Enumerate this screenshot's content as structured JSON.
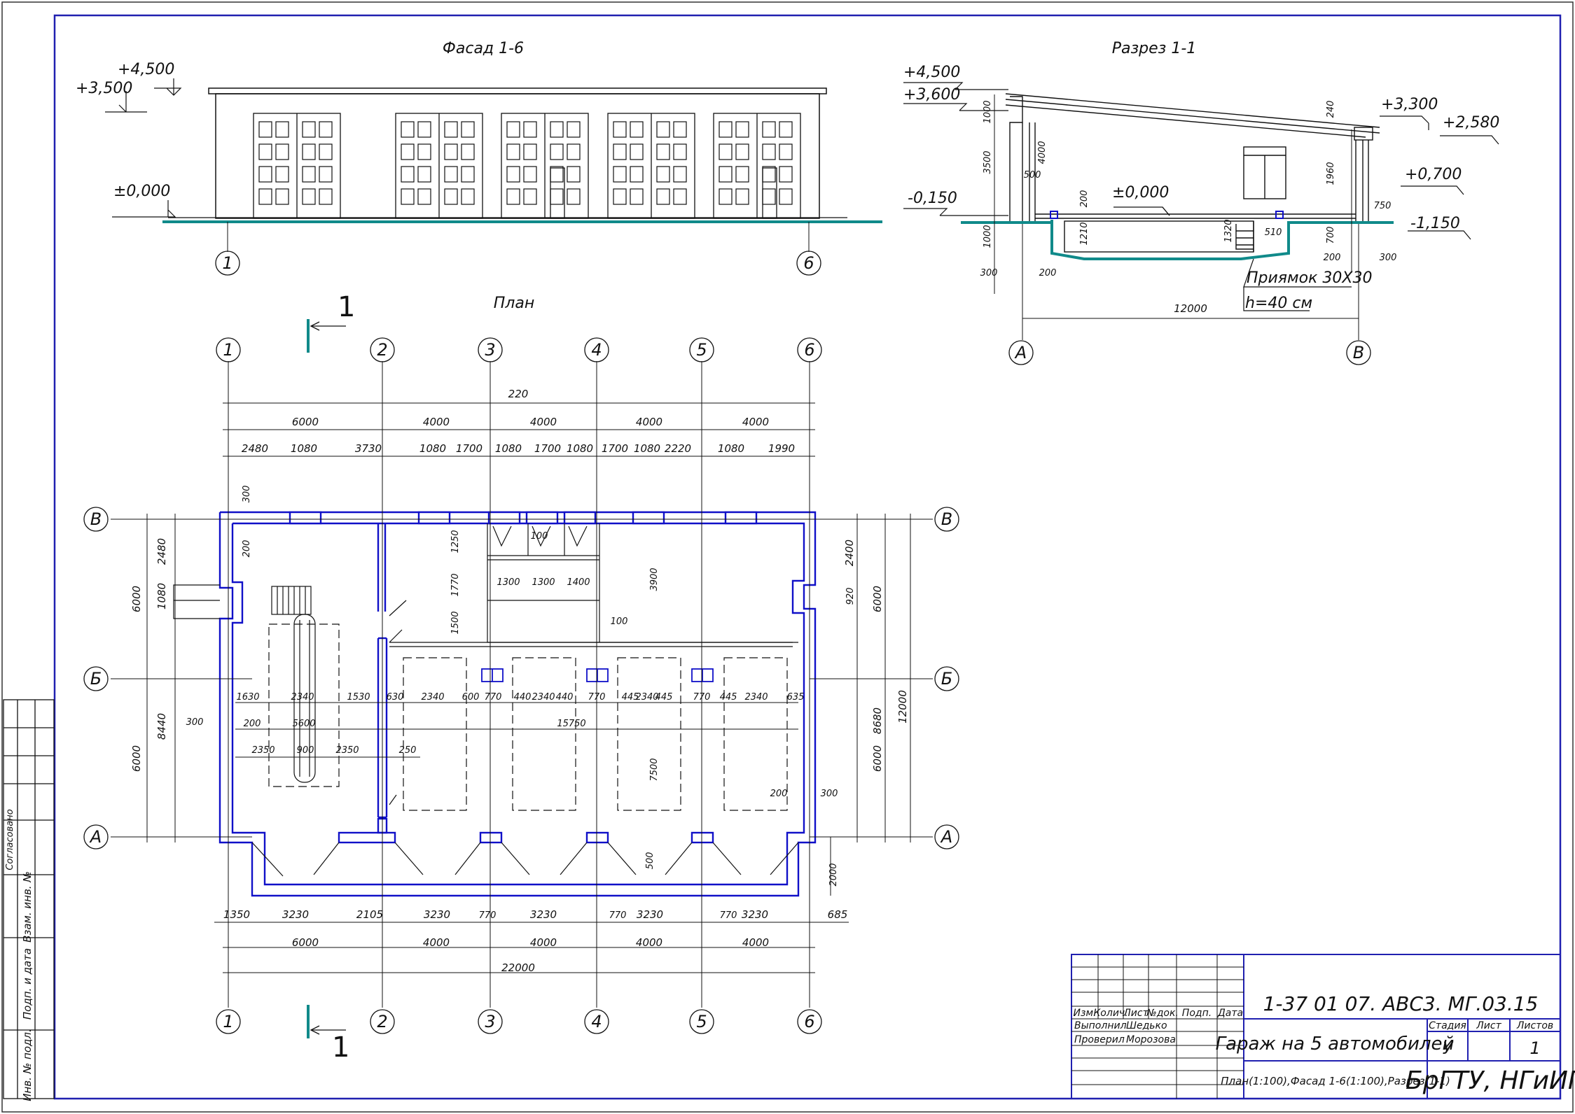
{
  "facade": {
    "title": "Фасад 1-6",
    "levels": [
      "+4,500",
      "+3,500",
      "±0,000"
    ],
    "axes": [
      "1",
      "6"
    ]
  },
  "section": {
    "title": "Разрез 1-1",
    "levels_left": [
      "+4,500",
      "+3,600",
      "-0,150"
    ],
    "levels_right": [
      "+3,300",
      "+2,580",
      "+0,700",
      "-1,150"
    ],
    "floor_level": "±0,000",
    "dims": [
      "1000",
      "3500",
      "1000",
      "300",
      "200",
      "500",
      "4000",
      "200",
      "1210",
      "1320",
      "510",
      "240",
      "1960",
      "700",
      "750",
      "200",
      "300",
      "12000"
    ],
    "pit_note": [
      "Приямок 30Х30",
      "h=40 см"
    ],
    "axes": [
      "А",
      "В"
    ]
  },
  "plan": {
    "title": "План",
    "section_mark": "1",
    "axes_x": [
      "1",
      "2",
      "3",
      "4",
      "5",
      "6"
    ],
    "axes_y": [
      "В",
      "Б",
      "А"
    ],
    "top_total": "220",
    "top_spans": [
      "6000",
      "4000",
      "4000",
      "4000",
      "4000"
    ],
    "top_details": [
      "2480",
      "1080",
      "3730",
      "1080",
      "1700",
      "1080",
      "1700",
      "1080",
      "1700",
      "1080",
      "2220",
      "1080",
      "1990"
    ],
    "bottom_details": [
      "1350",
      "3230",
      "2105",
      "3230",
      "770",
      "3230",
      "770",
      "3230",
      "770",
      "3230",
      "685"
    ],
    "bottom_spans": [
      "6000",
      "4000",
      "4000",
      "4000",
      "4000"
    ],
    "bottom_total": "22000",
    "left_dims": [
      "300",
      "200",
      "2480",
      "1080",
      "6000",
      "8440",
      "300",
      "6000"
    ],
    "right_dims": [
      "2400",
      "920",
      "6000",
      "8680",
      "12000",
      "6000",
      "300",
      "2000"
    ],
    "inner_dims": [
      "1250",
      "100",
      "1770",
      "1300",
      "1300",
      "1400",
      "1500",
      "100",
      "3900",
      "1630",
      "2340",
      "1530",
      "630",
      "2340",
      "600",
      "770",
      "440",
      "2340",
      "440",
      "770",
      "445",
      "2340",
      "445",
      "770",
      "445",
      "2340",
      "635",
      "200",
      "5600",
      "15750",
      "2350",
      "900",
      "2350",
      "250",
      "7500",
      "200",
      "500"
    ]
  },
  "side_stamp": {
    "labels": [
      "Согласовано",
      "Взам. инв. №",
      "Подп. и дата",
      "Инв. № подл."
    ]
  },
  "title_block": {
    "code": "1-37 01 07. АВС3. МГ.03.15",
    "headers": [
      "Изм.",
      "Колич.",
      "Лист",
      "№док.",
      "Подп.",
      "Дата"
    ],
    "roles": [
      "Выполнил",
      "Проверил"
    ],
    "names": [
      "Шедько",
      "Морозова"
    ],
    "object_name": "Гараж на 5 автомобилей",
    "stage_headers": [
      "Стадия",
      "Лист",
      "Листов"
    ],
    "stage_values": [
      "У",
      "",
      "1"
    ],
    "sheet_content": "План(1:100),Фасад 1-6(1:100),Разрез(1-1)",
    "organization": "БрГТУ, НГиИГ"
  },
  "colors": {
    "wall": "#1010c8",
    "ground": "#108a8a",
    "line": "#111111",
    "frame": "#2020b0"
  }
}
